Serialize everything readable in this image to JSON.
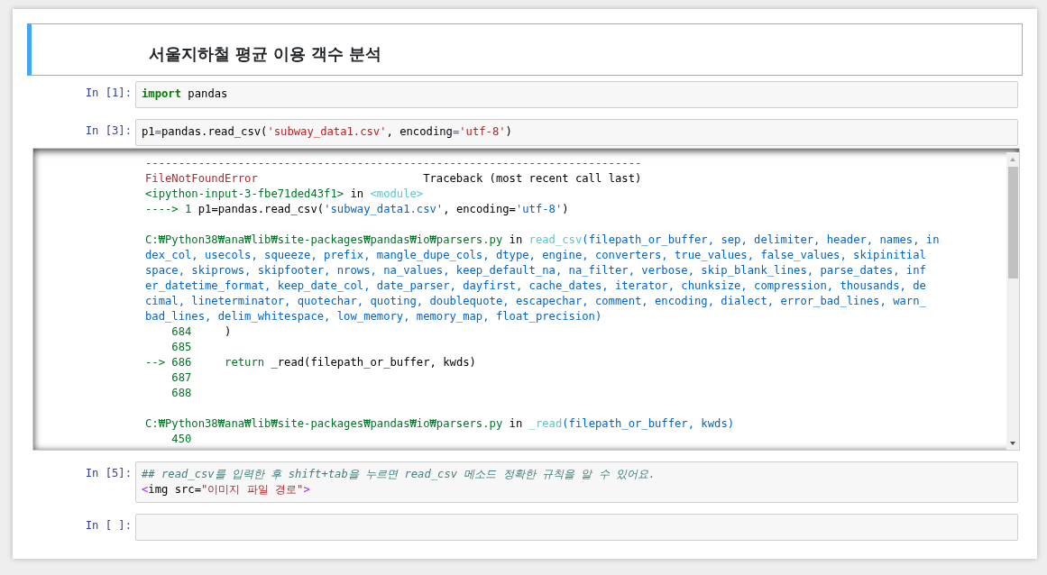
{
  "cells": [
    {
      "kind": "markdown",
      "selected": true,
      "heading": "서울지하철 평균 이용 객수 분석"
    },
    {
      "kind": "code",
      "selected": false,
      "prompt": "In [1]:",
      "lines": [
        [
          {
            "t": "import",
            "kind": "keyword"
          },
          {
            "t": " pandas",
            "kind": "plain"
          }
        ]
      ]
    },
    {
      "kind": "code",
      "selected": false,
      "prompt": "In [3]:",
      "lines": [
        [
          {
            "t": "p1",
            "kind": "plain"
          },
          {
            "t": "=",
            "kind": "op"
          },
          {
            "t": "pandas.read_csv(",
            "kind": "plain"
          },
          {
            "t": "'subway_data1.csv'",
            "kind": "str"
          },
          {
            "t": ", encoding",
            "kind": "plain"
          },
          {
            "t": "=",
            "kind": "op"
          },
          {
            "t": "'utf-8'",
            "kind": "str"
          },
          {
            "t": ")",
            "kind": "plain"
          }
        ]
      ],
      "output": [
        {
          "spans": [
            {
              "t": "---------------------------------------------------------------------------",
              "kind": "red"
            }
          ]
        },
        {
          "spans": [
            {
              "t": "FileNotFoundError",
              "kind": "red"
            },
            {
              "t": "                         Traceback (most recent call last)",
              "kind": "plain"
            }
          ]
        },
        {
          "spans": [
            {
              "t": "<ipython-input-3-fbe71ded43f1>",
              "kind": "green"
            },
            {
              "t": " in ",
              "kind": "plain"
            },
            {
              "t": "<module>",
              "kind": "cyan"
            }
          ]
        },
        {
          "spans": [
            {
              "t": "----> 1 ",
              "kind": "green"
            },
            {
              "t": "p1=pandas.read_csv(",
              "kind": "plain"
            },
            {
              "t": "'subway_data1.csv'",
              "kind": "blue"
            },
            {
              "t": ", encoding=",
              "kind": "plain"
            },
            {
              "t": "'utf-8'",
              "kind": "blue"
            },
            {
              "t": ")",
              "kind": "plain"
            }
          ]
        },
        {
          "spaced": true,
          "spans": [
            {
              "t": "C:₩Python38₩ana₩lib₩site-packages₩pandas₩io₩parsers.py",
              "kind": "green"
            },
            {
              "t": " in ",
              "kind": "plain"
            },
            {
              "t": "read_csv",
              "kind": "cyan"
            },
            {
              "t": "(filepath_or_buffer, sep, delimiter, header, names, in",
              "kind": "blue"
            }
          ]
        },
        {
          "spans": [
            {
              "t": "dex_col, usecols, squeeze, prefix, mangle_dupe_cols, dtype, engine, converters, true_values, false_values, skipinitial",
              "kind": "blue"
            }
          ]
        },
        {
          "spans": [
            {
              "t": "space, skiprows, skipfooter, nrows, na_values, keep_default_na, na_filter, verbose, skip_blank_lines, parse_dates, inf",
              "kind": "blue"
            }
          ]
        },
        {
          "spans": [
            {
              "t": "er_datetime_format, keep_date_col, date_parser, dayfirst, cache_dates, iterator, chunksize, compression, thousands, de",
              "kind": "blue"
            }
          ]
        },
        {
          "spans": [
            {
              "t": "cimal, lineterminator, quotechar, quoting, doublequote, escapechar, comment, encoding, dialect, error_bad_lines, warn_",
              "kind": "blue"
            }
          ]
        },
        {
          "spans": [
            {
              "t": "bad_lines, delim_whitespace, low_memory, memory_map, float_precision)",
              "kind": "blue"
            }
          ]
        },
        {
          "spans": [
            {
              "t": "    684",
              "kind": "lineno"
            },
            {
              "t": "     )",
              "kind": "plain"
            }
          ]
        },
        {
          "spans": [
            {
              "t": "    685",
              "kind": "lineno"
            }
          ]
        },
        {
          "spans": [
            {
              "t": "--> 686",
              "kind": "green"
            },
            {
              "t": "     return",
              "kind": "green"
            },
            {
              "t": " _read(filepath_or_buffer, kwds)",
              "kind": "plain"
            }
          ]
        },
        {
          "spans": [
            {
              "t": "    687",
              "kind": "lineno"
            }
          ]
        },
        {
          "spans": [
            {
              "t": "    688",
              "kind": "lineno"
            }
          ]
        },
        {
          "spaced": true,
          "spans": [
            {
              "t": "C:₩Python38₩ana₩lib₩site-packages₩pandas₩io₩parsers.py",
              "kind": "green"
            },
            {
              "t": " in ",
              "kind": "plain"
            },
            {
              "t": "_read",
              "kind": "cyan"
            },
            {
              "t": "(filepath_or_buffer, kwds)",
              "kind": "blue"
            }
          ]
        },
        {
          "spans": [
            {
              "t": "    450",
              "kind": "lineno"
            }
          ]
        }
      ]
    },
    {
      "kind": "code",
      "selected": false,
      "prompt": "In [5]:",
      "lines": [
        [
          {
            "t": "## read_csv를 입력한 후 shift+tab을 누르면 read_csv 메소드 정확한 규칙을 알 수 있어요.",
            "kind": "comment"
          }
        ],
        [
          {
            "t": "<",
            "kind": "op"
          },
          {
            "t": "img src=",
            "kind": "plain"
          },
          {
            "t": "\"이미지 파일 경로\"",
            "kind": "str"
          },
          {
            "t": ">",
            "kind": "op"
          }
        ]
      ]
    },
    {
      "kind": "code",
      "selected": false,
      "prompt": "In [ ]:"
    }
  ]
}
